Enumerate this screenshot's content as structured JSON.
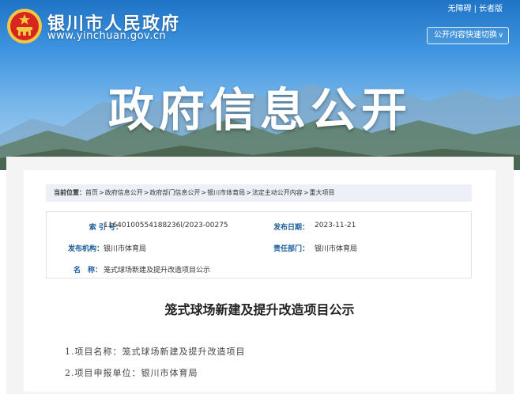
{
  "header": {
    "site_name": "银川市人民政府",
    "site_url": "www.yinchuan.gov.cn",
    "accessibility_link": "无障碍",
    "separator": "|",
    "elder_mode_link": "长者版",
    "quick_switch_label": "公开内容快速切换",
    "hero_title": "政府信息公开"
  },
  "breadcrumb": {
    "label": "当前位置：",
    "items": [
      "首页",
      "政府信息公开",
      "政府部门信息公开",
      "银川市体育局",
      "法定主动公开内容",
      "重大项目"
    ],
    "separator": ">"
  },
  "info": {
    "index_label": "索 引 号：",
    "index_value": "11640100554188236l/2023-00275",
    "date_label": "发布日期：",
    "date_value": "2023-11-21",
    "org_label": "发布机构：",
    "org_value": "银川市体育局",
    "dept_label": "责任部门：",
    "dept_value": "银川市体育局",
    "name_label": "名　称：",
    "name_value": "笼式球场新建及提升改造项目公示"
  },
  "article": {
    "title": "笼式球场新建及提升改造项目公示",
    "lines": [
      "1.项目名称：笼式球场新建及提升改造项目",
      "2.项目申报单位：银川市体育局"
    ]
  },
  "colors": {
    "banner_top": "#1f74c6",
    "label_blue": "#1a5c9a",
    "breadcrumb_bg": "#edf1f7",
    "emblem_red": "#d7261e",
    "emblem_gold": "#f3c744"
  }
}
